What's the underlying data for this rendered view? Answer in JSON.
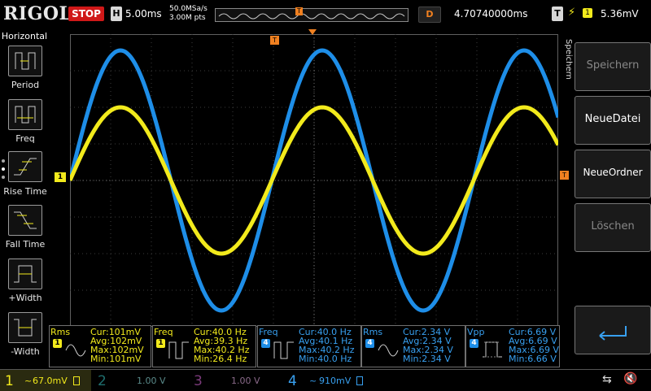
{
  "header": {
    "logo": "RIGOL",
    "run_state": "STOP",
    "horiz_label": "H",
    "timebase": "5.00ms",
    "sample_rate": "50.0MSa/s",
    "memory_depth": "3.00M pts",
    "delay_label": "D",
    "delay": "4.70740000ms",
    "trigger_label": "T",
    "trigger_level": "5.36mV"
  },
  "left_menu": {
    "title": "Horizontal",
    "items": [
      "Period",
      "Freq",
      "Rise Time",
      "Fall Time",
      "+Width",
      "-Width"
    ]
  },
  "right_menu": {
    "title": "Speichern",
    "items": [
      "Speichern",
      "NeueDatei",
      "NeueOrdner",
      "Löschen"
    ]
  },
  "measurements": [
    {
      "name": "Rms",
      "ch": "1",
      "cur": "Cur:101mV",
      "avg": "Avg:102mV",
      "max": "Max:102mV",
      "min": "Min:101mV"
    },
    {
      "name": "Freq",
      "ch": "1",
      "cur": "Cur:40.0 Hz",
      "avg": "Avg:39.3 Hz",
      "max": "Max:40.2 Hz",
      "min": "Min:26.4 Hz"
    },
    {
      "name": "Freq",
      "ch": "4",
      "cur": "Cur:40.0 Hz",
      "avg": "Avg:40.1 Hz",
      "max": "Max:40.2 Hz",
      "min": "Min:40.0 Hz"
    },
    {
      "name": "Rms",
      "ch": "4",
      "cur": "Cur:2.34 V",
      "avg": "Avg:2.34 V",
      "max": "Max:2.34 V",
      "min": "Min:2.34 V"
    },
    {
      "name": "Vpp",
      "ch": "4",
      "cur": "Cur:6.69 V",
      "avg": "Avg:6.69 V",
      "max": "Max:6.69 V",
      "min": "Min:6.66 V"
    }
  ],
  "channels": [
    {
      "num": "1",
      "scale": "67.0mV",
      "coupling": "~"
    },
    {
      "num": "2",
      "scale": "1.00 V",
      "coupling": ""
    },
    {
      "num": "3",
      "scale": "1.00 V",
      "coupling": ""
    },
    {
      "num": "4",
      "scale": "910mV",
      "coupling": "~"
    }
  ],
  "markers": {
    "ch1": "1",
    "trigger": "T"
  },
  "colors": {
    "ch1": "#f2ea1c",
    "ch4": "#1e8ee8",
    "ch2": "#00c8c8",
    "ch3": "#d050d0",
    "stop": "#d01818",
    "accent": "#f08020"
  }
}
